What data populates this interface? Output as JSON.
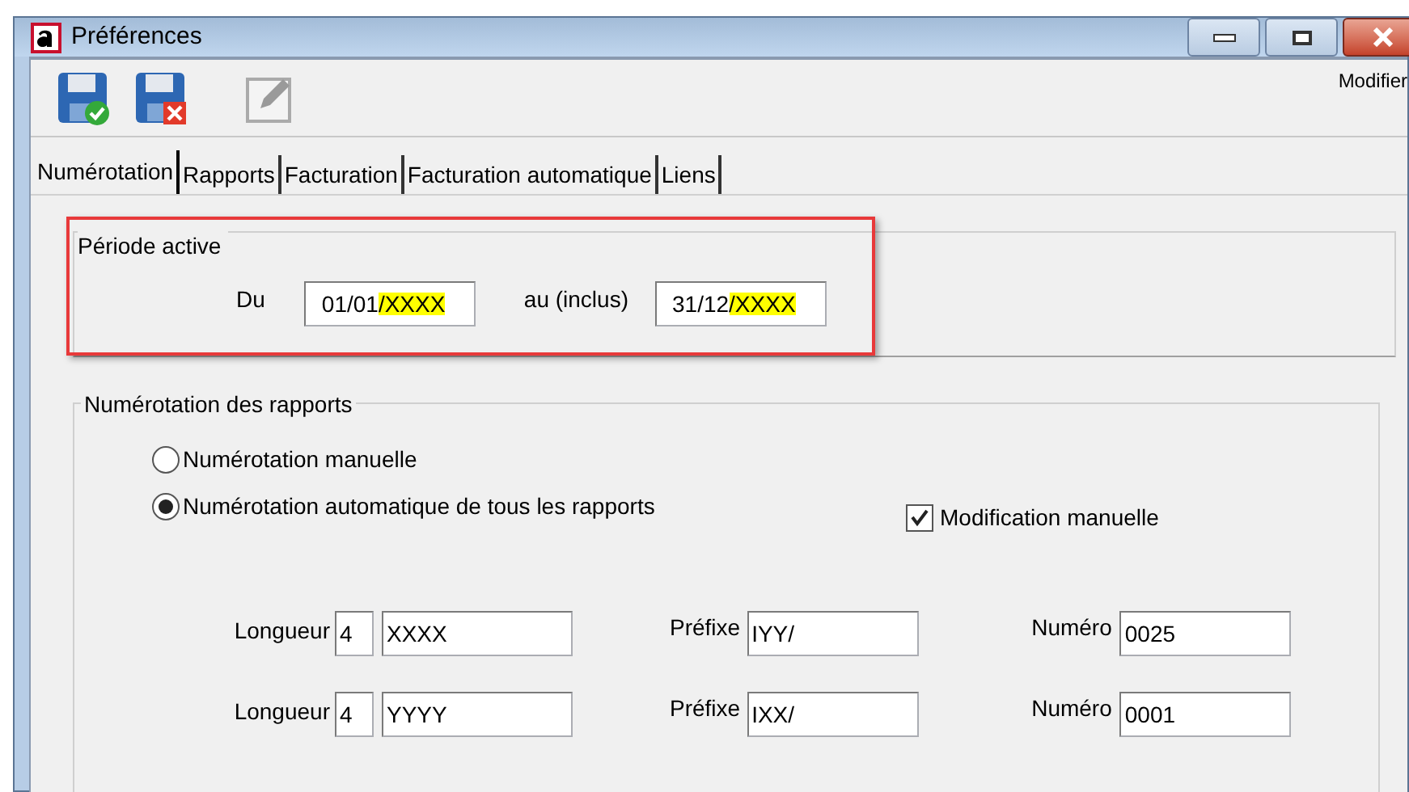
{
  "window": {
    "title": "Préférences"
  },
  "toolbar": {
    "right_label": "Modifier"
  },
  "tabs": [
    {
      "label": "Numérotation",
      "selected": true
    },
    {
      "label": "Rapports",
      "selected": false
    },
    {
      "label": "Facturation",
      "selected": false
    },
    {
      "label": "Facturation automatique",
      "selected": false
    },
    {
      "label": "Liens",
      "selected": false
    }
  ],
  "periode": {
    "title": "Période active",
    "highlighted": true,
    "from_label": "Du",
    "from_value": "01/01",
    "from_highlight": "/XXXX",
    "to_label": "au (inclus)",
    "to_value": "31/12",
    "to_highlight": "/XXXX"
  },
  "numerotation": {
    "title": "Numérotation des rapports",
    "radios": [
      {
        "label": "Numérotation manuelle",
        "selected": false
      },
      {
        "label": "Numérotation automatique de tous les rapports",
        "selected": true
      }
    ],
    "checkbox": {
      "label": "Modification manuelle",
      "checked": true
    },
    "rows": [
      {
        "length_label": "Longueur",
        "length": "4",
        "format": "XXXX",
        "prefix_label": "Préfixe",
        "prefix": "IYY/",
        "number_label": "Numéro",
        "number": "0025"
      },
      {
        "length_label": "Longueur",
        "length": "4",
        "format": "YYYY",
        "prefix_label": "Préfixe",
        "prefix": "IXX/",
        "number_label": "Numéro",
        "number": "0001"
      }
    ]
  }
}
